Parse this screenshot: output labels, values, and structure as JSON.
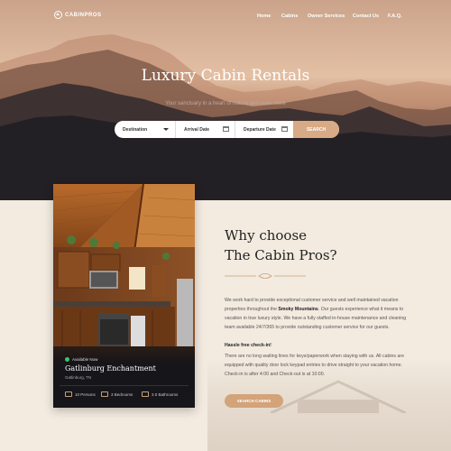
{
  "brand": {
    "logo_text": "CABINPROS"
  },
  "nav": {
    "items": [
      "Home",
      "Cabins",
      "Owner Services",
      "Contact Us",
      "F.A.Q."
    ]
  },
  "hero": {
    "title": "Luxury Cabin Rentals",
    "subtitle": "Your sanctuary in a heart of nature and even more"
  },
  "search": {
    "destination_label": "Destination",
    "arrival_label": "Arrival Date",
    "departure_label": "Departure Date",
    "button_label": "SEARCH"
  },
  "card": {
    "status": "Available Now",
    "name": "Gatlinburg Enchantment",
    "location": "Gatlinburg, TN",
    "features": [
      "10 Persons",
      "3 Bedrooms",
      "3.0 Bathrooms"
    ],
    "status_color": "#3cc46a"
  },
  "about": {
    "heading_line1": "Why choose",
    "heading_line2": "The Cabin Pros?",
    "p1_before": "We work hard to provide exceptional customer service and well maintained vacation properties throughout the ",
    "p1_bold": "Smoky Mountains",
    "p1_after": ". Our guests experience what it means to vacation in true luxury style. We have a fully staffed in-house maintenance and cleaning team available 24/7/365 to provide outstanding customer service for our guests.",
    "hassle_title": "Hassle free check-in!",
    "p2": "There are no long waiting lines for keys/paperwork when staying with us. All cabins are equipped with quality door lock keypad entries to drive straight to your vacation home. Check-in is after 4:00 and Check-out is at 10:00.",
    "cta_label": "SEARCH CABINS"
  },
  "colors": {
    "accent": "#d3a37a",
    "hero_dark": "#1d1c22",
    "bg": "#f3ebe0"
  }
}
